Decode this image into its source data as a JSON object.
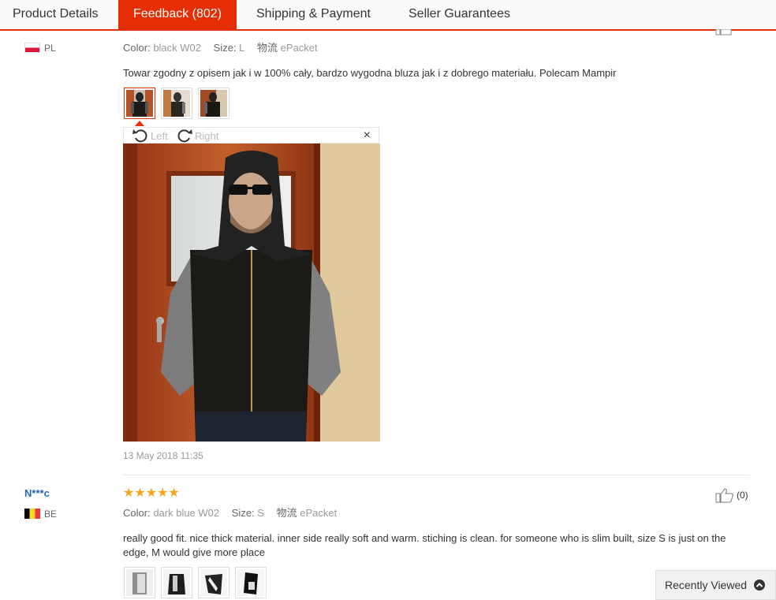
{
  "tabs": [
    {
      "label": "Product Details"
    },
    {
      "label": "Feedback (802)"
    },
    {
      "label": "Shipping & Payment"
    },
    {
      "label": "Seller Guarantees"
    }
  ],
  "review1": {
    "country": "PL",
    "color_key": "Color:",
    "color_val": "black W02",
    "size_key": "Size:",
    "size_val": "L",
    "ship_key": "物流",
    "ship_val": "ePacket",
    "text": "Towar zgodny z opisem jak i w 100% cały, bardzo wygodna bluza jak i z dobrego materiału. Polecam Mampir",
    "viewer": {
      "left": "Left",
      "right": "Right",
      "close": "×"
    },
    "date": "13 May 2018 11:35"
  },
  "review2": {
    "user": "N***c",
    "country": "BE",
    "stars": "★★★★★",
    "rating": 5,
    "color_key": "Color:",
    "color_val": "dark blue W02",
    "size_key": "Size:",
    "size_val": "S",
    "ship_key": "物流",
    "ship_val": "ePacket",
    "likes": "(0)",
    "text": "really good fit. nice thick material. inner side really soft and warm. stiching is clean. for someone who is slim built, size S is just on the edge, M would give more place"
  },
  "recently_viewed": "Recently Viewed",
  "colors": {
    "accent": "#e62e04",
    "link": "#2668b3",
    "star": "#f4a51c"
  }
}
